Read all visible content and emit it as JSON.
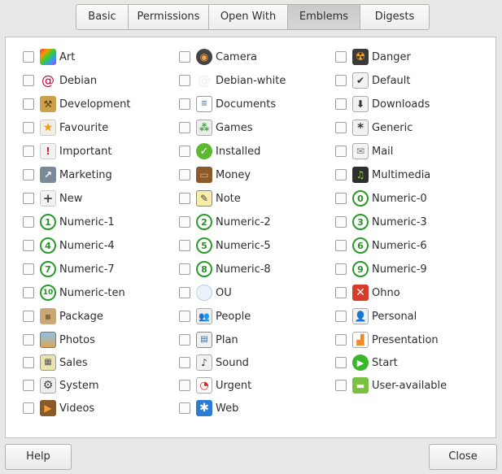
{
  "tabs": [
    "Basic",
    "Permissions",
    "Open With",
    "Emblems",
    "Digests"
  ],
  "active_tab": "Emblems",
  "emblems": [
    [
      "Art",
      "Debian",
      "Development",
      "Favourite",
      "Important",
      "Marketing",
      "New",
      "Numeric-1",
      "Numeric-4",
      "Numeric-7",
      "Numeric-ten",
      "Package",
      "Photos",
      "Sales",
      "System",
      "Videos"
    ],
    [
      "Camera",
      "Debian-white",
      "Documents",
      "Games",
      "Installed",
      "Money",
      "Note",
      "Numeric-2",
      "Numeric-5",
      "Numeric-8",
      "OU",
      "People",
      "Plan",
      "Sound",
      "Urgent",
      "Web"
    ],
    [
      "Danger",
      "Default",
      "Downloads",
      "Generic",
      "Mail",
      "Multimedia",
      "Numeric-0",
      "Numeric-3",
      "Numeric-6",
      "Numeric-9",
      "Ohno",
      "Personal",
      "Presentation",
      "Start",
      "User-available"
    ]
  ],
  "buttons": {
    "help": "Help",
    "close": "Close"
  }
}
